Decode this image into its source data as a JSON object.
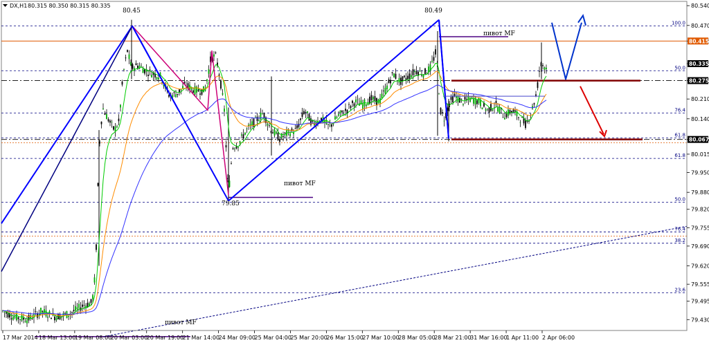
{
  "chart_data": {
    "type": "candlestick",
    "symbol_label": "DX,H1",
    "ohlc_label": "80.315 80.350 80.315 80.335",
    "ylim": [
      79.35,
      80.56
    ],
    "grid": false,
    "y_ticks": [
      "80.540",
      "80.470",
      "80.415",
      "80.335",
      "80.275",
      "80.210",
      "80.140",
      "80.067",
      "80.015",
      "79.950",
      "79.880",
      "79.820",
      "79.755",
      "79.690",
      "79.620",
      "79.555",
      "79.495",
      "79.430"
    ],
    "x_labels": [
      "17 Mar 2014",
      "18 Mar 13:00",
      "19 Mar 08:00",
      "20 Mar 03:00",
      "20 Mar 19:00",
      "21 Mar 14:00",
      "24 Mar 09:00",
      "25 Mar 04:00",
      "25 Mar 20:00",
      "26 Mar 15:00",
      "27 Mar 10:00",
      "28 Mar 05:00",
      "28 Mar 21:00",
      "31 Mar 16:00",
      "1 Apr 11:00",
      "2 Apr 06:00"
    ],
    "price_boxes": [
      {
        "text": "80.415",
        "value": 80.415,
        "bg": "#e05a00",
        "fg": "#ffffff"
      },
      {
        "text": "80.335",
        "value": 80.335,
        "bg": "#000000",
        "fg": "#ffffff"
      },
      {
        "text": "80.275",
        "value": 80.275,
        "bg": "#000000",
        "fg": "#ffffff"
      },
      {
        "text": "80.067",
        "value": 80.067,
        "bg": "#000000",
        "fg": "#ffffff"
      }
    ],
    "fib_labels": [
      {
        "text": "100.0",
        "value": 80.468
      },
      {
        "text": "50.0",
        "value": 80.31
      },
      {
        "text": "76.4",
        "value": 80.16
      },
      {
        "text": "61.8",
        "value": 80.072
      },
      {
        "text": "61.8",
        "value": 80.0
      },
      {
        "text": "50.0",
        "value": 79.845
      },
      {
        "text": "76.4",
        "value": 79.74
      },
      {
        "text": "38.2",
        "value": 79.7
      },
      {
        "text": "23.6",
        "value": 79.525
      }
    ],
    "peak_labels": [
      {
        "text": "80.45",
        "x": "20 Mar 03:00",
        "value": 80.45
      },
      {
        "text": "80.49",
        "x": "28 Mar 21:00",
        "value": 80.49
      },
      {
        "text": "79.85",
        "x": "24 Mar 09:00",
        "value": 79.85
      }
    ],
    "annotations": [
      {
        "text": "пивот MF",
        "value": 80.43
      },
      {
        "text": "пивот MF",
        "value": 79.862
      },
      {
        "text": "пивот MF",
        "value": 79.37
      }
    ],
    "colors": {
      "bull": "#00aa00",
      "bear": "#000000",
      "ma_fast": "#00cc00",
      "ma_mid": "#ff8c00",
      "ma_slow": "#3333ff",
      "wave": "#0000ff",
      "wave_pink": "#cc0077",
      "arrow_up": "#0033cc",
      "arrow_down": "#dd0000",
      "level_dark": "#800000",
      "pivot": "#4b0082",
      "fib": "#000080",
      "orange_level": "#e05a00"
    }
  }
}
